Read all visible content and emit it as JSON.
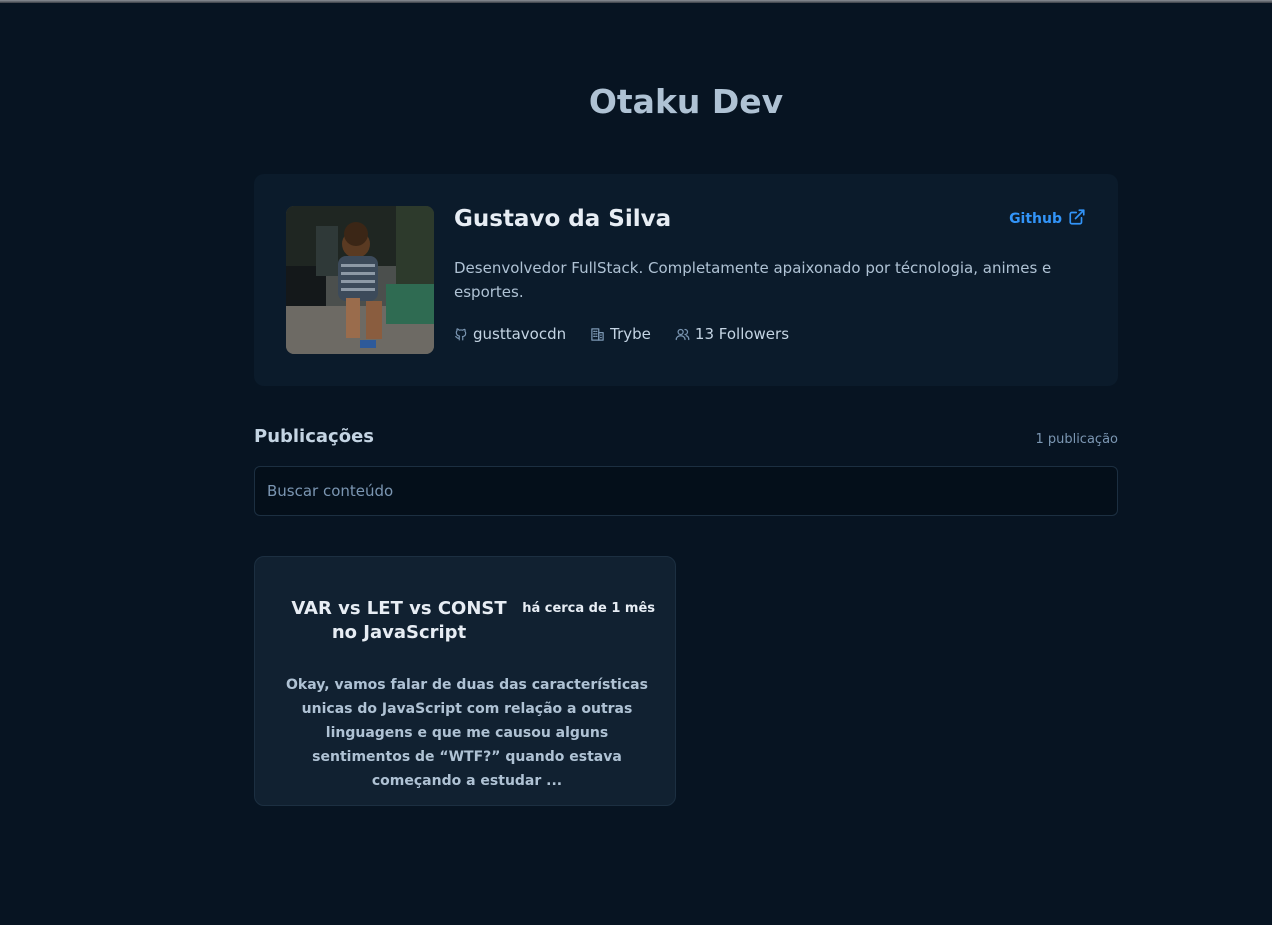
{
  "site": {
    "title": "Otaku Dev"
  },
  "profile": {
    "name": "Gustavo da Silva",
    "github_label": "Github",
    "bio": "Desenvolvedor FullStack. Completamente apaixonado por técnologia, animes e esportes.",
    "username": "gusttavocdn",
    "company": "Trybe",
    "followers": "13 Followers"
  },
  "publications": {
    "title": "Publicações",
    "count": "1 publicação",
    "search_placeholder": "Buscar conteúdo",
    "posts": [
      {
        "title": "VAR vs LET vs CONST no JavaScript",
        "date": "há cerca de 1 mês",
        "excerpt": "Okay, vamos falar de duas das características unicas do JavaScript com relação a outras linguagens e que me causou alguns sentimentos de “WTF?” quando estava começando a estudar ..."
      }
    ]
  },
  "colors": {
    "background": "#071422",
    "profile_bg": "#0b1b2b",
    "post_bg": "#112131",
    "accent_blue": "#3294f8",
    "title_text": "#afc2d4"
  },
  "icons": {
    "github": "github-icon",
    "external": "external-link-icon",
    "company": "building-icon",
    "followers": "users-icon"
  }
}
